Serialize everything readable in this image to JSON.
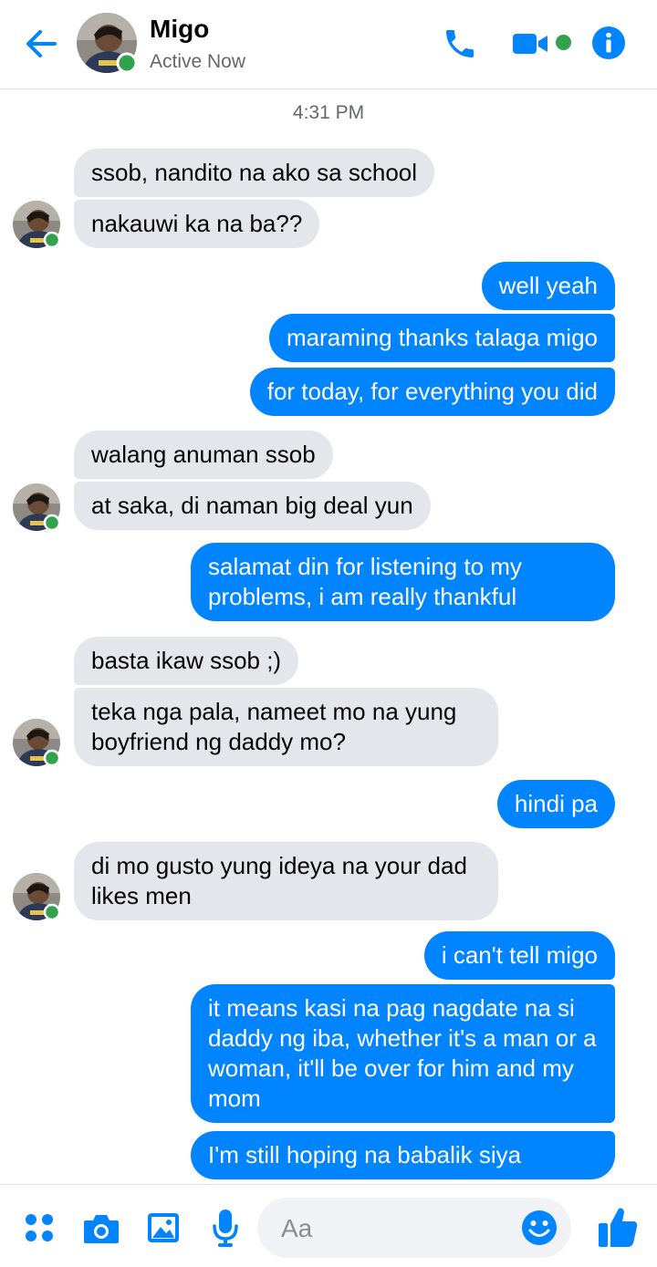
{
  "colors": {
    "accent": "#0084ff",
    "incoming_bubble": "#e4e6eb",
    "online": "#31a24c"
  },
  "header": {
    "back_icon": "arrow-left-icon",
    "contact_name": "Migo",
    "status": "Active Now",
    "call_icon": "phone-icon",
    "video_icon": "video-camera-icon",
    "info_icon": "info-icon"
  },
  "chat": {
    "timestamp": "4:31 PM",
    "messages": [
      {
        "from": "contact",
        "text": "ssob, nandito na ako sa school"
      },
      {
        "from": "contact",
        "text": "nakauwi ka na ba??"
      },
      {
        "from": "me",
        "text": "well yeah"
      },
      {
        "from": "me",
        "text": "maraming thanks talaga migo"
      },
      {
        "from": "me",
        "text": "for today, for everything you did"
      },
      {
        "from": "contact",
        "text": "walang anuman ssob"
      },
      {
        "from": "contact",
        "text": "at saka, di naman big deal yun"
      },
      {
        "from": "me",
        "text": "salamat din for listening to my problems, i am really thankful"
      },
      {
        "from": "contact",
        "text": "basta ikaw ssob ;)"
      },
      {
        "from": "contact",
        "text": "teka nga pala, nameet mo na yung boyfriend ng daddy mo?"
      },
      {
        "from": "me",
        "text": "hindi pa"
      },
      {
        "from": "contact",
        "text": "di mo gusto yung ideya na your dad likes men"
      },
      {
        "from": "me",
        "text": "i can't tell migo"
      },
      {
        "from": "me",
        "text": "it means kasi na pag nagdate na si daddy ng iba, whether it's a man or a woman, it'll be over for him and my mom"
      },
      {
        "from": "me",
        "text": "I'm still hoping na babalik siya"
      }
    ]
  },
  "composer": {
    "apps_icon": "four-dots-icon",
    "camera_icon": "camera-icon",
    "gallery_icon": "image-icon",
    "mic_icon": "microphone-icon",
    "placeholder": "Aa",
    "emoji_icon": "smiley-icon",
    "like_icon": "thumbs-up-icon"
  }
}
